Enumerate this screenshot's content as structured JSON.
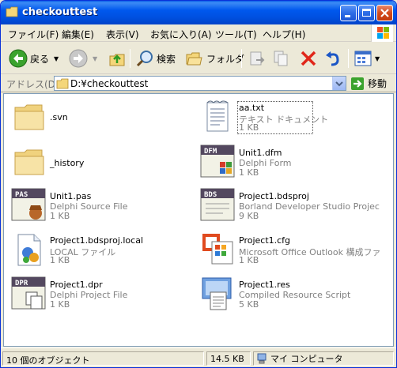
{
  "window": {
    "title": "checkouttest"
  },
  "menu": [
    "ファイル(F)",
    "編集(E)",
    "表示(V)",
    "お気に入り(A)",
    "ツール(T)",
    "ヘルプ(H)"
  ],
  "toolbar": {
    "back_label": "戻る",
    "search_label": "検索",
    "folders_label": "フォルダ"
  },
  "address": {
    "label": "アドレス(D)",
    "value": "D:¥checkouttest",
    "go_label": "移動"
  },
  "files": [
    {
      "name": ".svn",
      "type": "",
      "size": "",
      "icon": "folder-icon"
    },
    {
      "name": "aa.txt",
      "type": "テキスト ドキュメント",
      "size": "1 KB",
      "icon": "text-document-icon"
    },
    {
      "name": "_history",
      "type": "",
      "size": "",
      "icon": "folder-icon"
    },
    {
      "name": "Unit1.dfm",
      "type": "Delphi Form",
      "size": "1 KB",
      "icon": "delphi-form-icon"
    },
    {
      "name": "Unit1.pas",
      "type": "Delphi Source File",
      "size": "1 KB",
      "icon": "delphi-source-icon"
    },
    {
      "name": "Project1.bdsproj",
      "type": "Borland Developer Studio Project...",
      "size": "9 KB",
      "icon": "bds-project-icon"
    },
    {
      "name": "Project1.bdsproj.local",
      "type": "LOCAL ファイル",
      "size": "1 KB",
      "icon": "local-file-icon"
    },
    {
      "name": "Project1.cfg",
      "type": "Microsoft Office Outlook 構成ファ...",
      "size": "1 KB",
      "icon": "office-config-icon"
    },
    {
      "name": "Project1.dpr",
      "type": "Delphi Project File",
      "size": "1 KB",
      "icon": "delphi-project-icon"
    },
    {
      "name": "Project1.res",
      "type": "Compiled Resource Script",
      "size": "5 KB",
      "icon": "resource-script-icon"
    }
  ],
  "status": {
    "count": "10 個のオブジェクト",
    "size": "14.5 KB",
    "location": "マイ コンピュータ"
  }
}
